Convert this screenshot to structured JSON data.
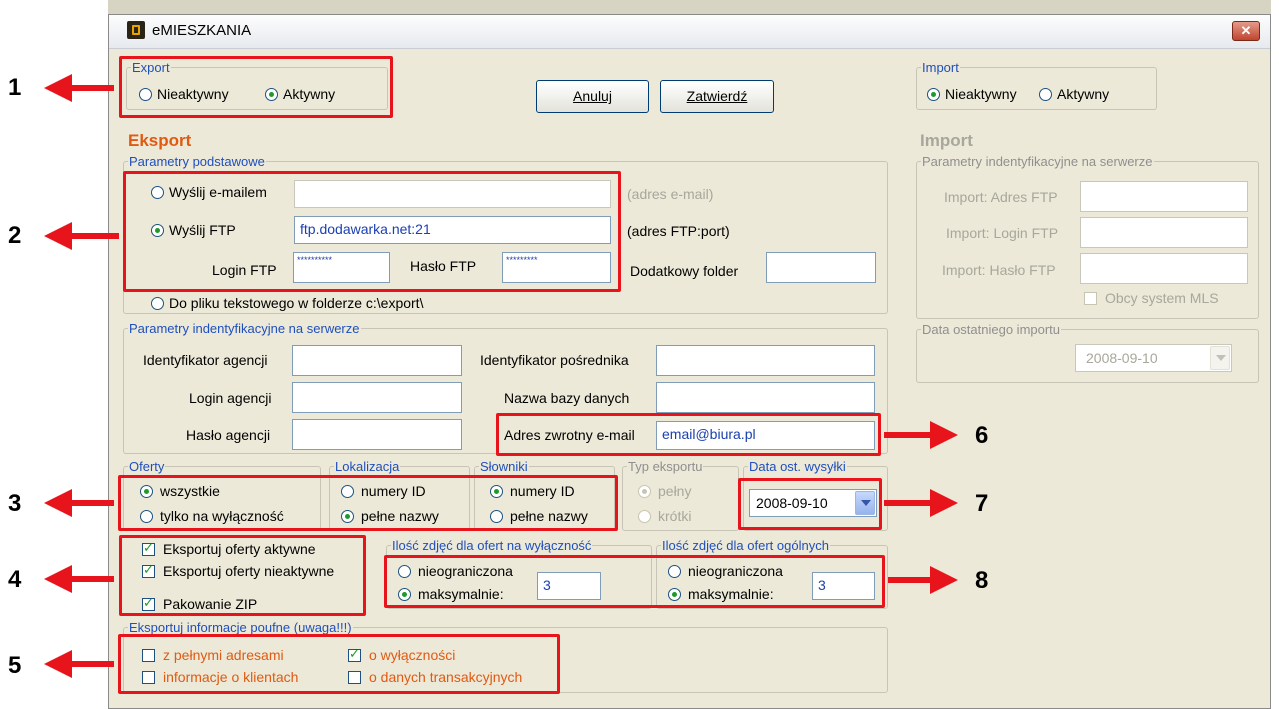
{
  "window": {
    "title": "eMIESZKANIA",
    "close_symbol": "✕"
  },
  "export_toggle": {
    "legend": "Export",
    "inactive": "Nieaktywny",
    "active": "Aktywny",
    "selected": "Aktywny"
  },
  "import_toggle": {
    "legend": "Import",
    "inactive": "Nieaktywny",
    "active": "Aktywny",
    "selected": "Nieaktywny"
  },
  "buttons": {
    "cancel": "Anuluj",
    "confirm": "Zatwierdź"
  },
  "export": {
    "title": "Eksport",
    "basic": {
      "legend": "Parametry podstawowe",
      "send_email": "Wyślij e-mailem",
      "email_value": "",
      "email_hint": "(adres e-mail)",
      "send_ftp": "Wyślij FTP",
      "ftp_value": "ftp.dodawarka.net:21",
      "ftp_hint": "(adres FTP:port)",
      "login_ftp_label": "Login FTP",
      "login_ftp_value": "**********",
      "pass_ftp_label": "Hasło FTP",
      "pass_ftp_value": "*********",
      "extra_folder_label": "Dodatkowy folder",
      "extra_folder_value": "",
      "to_file": "Do pliku tekstowego w folderze c:\\export\\",
      "selected": "Wyślij FTP"
    },
    "server": {
      "legend": "Parametry indentyfikacyjne na serwerze",
      "agency_id_label": "Identyfikator agencji",
      "agency_id_value": "",
      "agency_login_label": "Login agencji",
      "agency_login_value": "",
      "agency_pass_label": "Hasło agencji",
      "agency_pass_value": "",
      "broker_id_label": "Identyfikator pośrednika",
      "broker_id_value": "",
      "db_name_label": "Nazwa bazy danych",
      "db_name_value": "",
      "return_email_label": "Adres zwrotny e-mail",
      "return_email_value": "email@biura.pl"
    },
    "offers": {
      "legend": "Oferty",
      "all": "wszystkie",
      "exclusive": "tylko na wyłączność",
      "selected": "wszystkie"
    },
    "localization": {
      "legend": "Lokalizacja",
      "ids": "numery ID",
      "names": "pełne nazwy",
      "selected": "pełne nazwy"
    },
    "dictionaries": {
      "legend": "Słowniki",
      "ids": "numery ID",
      "names": "pełne nazwy",
      "selected": "numery ID"
    },
    "export_type": {
      "legend": "Typ eksportu",
      "full": "pełny",
      "short": "krótki",
      "selected": "pełny"
    },
    "last_send": {
      "legend": "Data ost. wysyłki",
      "value": "2008-09-10"
    },
    "checkboxes": {
      "active_offers": "Eksportuj oferty aktywne",
      "inactive_offers": "Eksportuj oferty nieaktywne",
      "zip": "Pakowanie ZIP"
    },
    "photos_exclusive": {
      "legend": "Ilość zdjęć dla ofert na wyłączność",
      "unlimited": "nieograniczona",
      "max": "maksymalnie:",
      "value": "3",
      "selected": "maksymalnie:"
    },
    "photos_general": {
      "legend": "Ilość zdjęć dla ofert ogólnych",
      "unlimited": "nieograniczona",
      "max": "maksymalnie:",
      "value": "3",
      "selected": "maksymalnie:"
    },
    "confidential": {
      "legend": "Eksportuj informacje poufne (uwaga!!!)",
      "full_addresses": "z pełnymi adresami",
      "exclusivity": "o wyłączności",
      "clients": "informacje o klientach",
      "transactions": "o danych transakcyjnych"
    }
  },
  "import": {
    "title": "Import",
    "server": {
      "legend": "Parametry indentyfikacyjne na serwerze",
      "ftp_address_label": "Import: Adres FTP",
      "ftp_login_label": "Import: Login FTP",
      "ftp_pass_label": "Import: Hasło FTP",
      "mls_label": "Obcy system MLS"
    },
    "last_import": {
      "legend": "Data ostatniego importu",
      "value": "2008-09-10"
    }
  },
  "annotations": [
    "1",
    "2",
    "3",
    "4",
    "5",
    "6",
    "7",
    "8"
  ],
  "colors": {
    "annotation_red": "#e8141c",
    "legend_blue": "#1f4fbd",
    "section_orange": "#e05a12",
    "window_bg": "#ece9d8"
  }
}
